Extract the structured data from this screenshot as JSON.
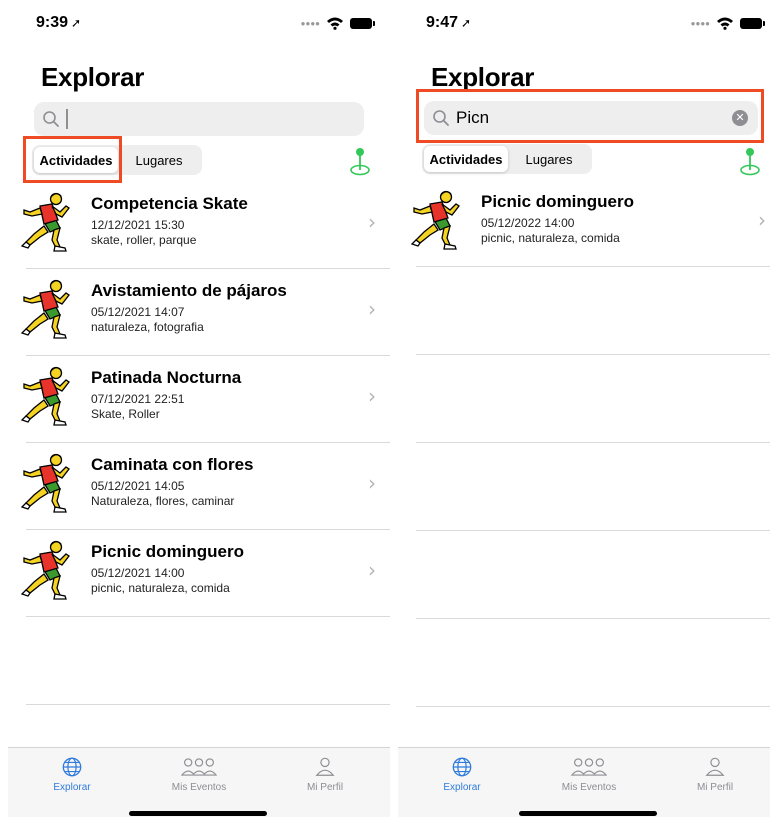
{
  "left": {
    "status": {
      "time": "9:39"
    },
    "title": "Explorar",
    "search": {
      "value": "",
      "placeholder": ""
    },
    "segments": {
      "selected": "Actividades",
      "other": "Lugares"
    },
    "items": [
      {
        "title": "Competencia Skate",
        "date": "12/12/2021 15:30",
        "tags": "skate, roller, parque"
      },
      {
        "title": "Avistamiento de pájaros",
        "date": "05/12/2021 14:07",
        "tags": "naturaleza, fotografia"
      },
      {
        "title": "Patinada Nocturna",
        "date": "07/12/2021 22:51",
        "tags": "Skate, Roller"
      },
      {
        "title": "Caminata con flores",
        "date": "05/12/2021 14:05",
        "tags": "Naturaleza, flores, caminar"
      },
      {
        "title": "Picnic dominguero",
        "date": "05/12/2021 14:00",
        "tags": "picnic, naturaleza, comida"
      }
    ]
  },
  "right": {
    "status": {
      "time": "9:47"
    },
    "title": "Explorar",
    "search": {
      "value": "Picn"
    },
    "segments": {
      "selected": "Actividades",
      "other": "Lugares"
    },
    "items": [
      {
        "title": "Picnic dominguero",
        "date": "05/12/2022 14:00",
        "tags": "picnic, naturaleza, comida"
      }
    ]
  },
  "tabbar": {
    "tabs": [
      {
        "label": "Explorar",
        "icon": "globe-icon"
      },
      {
        "label": "Mis Eventos",
        "icon": "people-icon"
      },
      {
        "label": "Mi Perfil",
        "icon": "person-icon"
      }
    ]
  },
  "colors": {
    "accent": "#2f7bdc",
    "highlight": "#ee4b24",
    "pin": "#34c759"
  }
}
